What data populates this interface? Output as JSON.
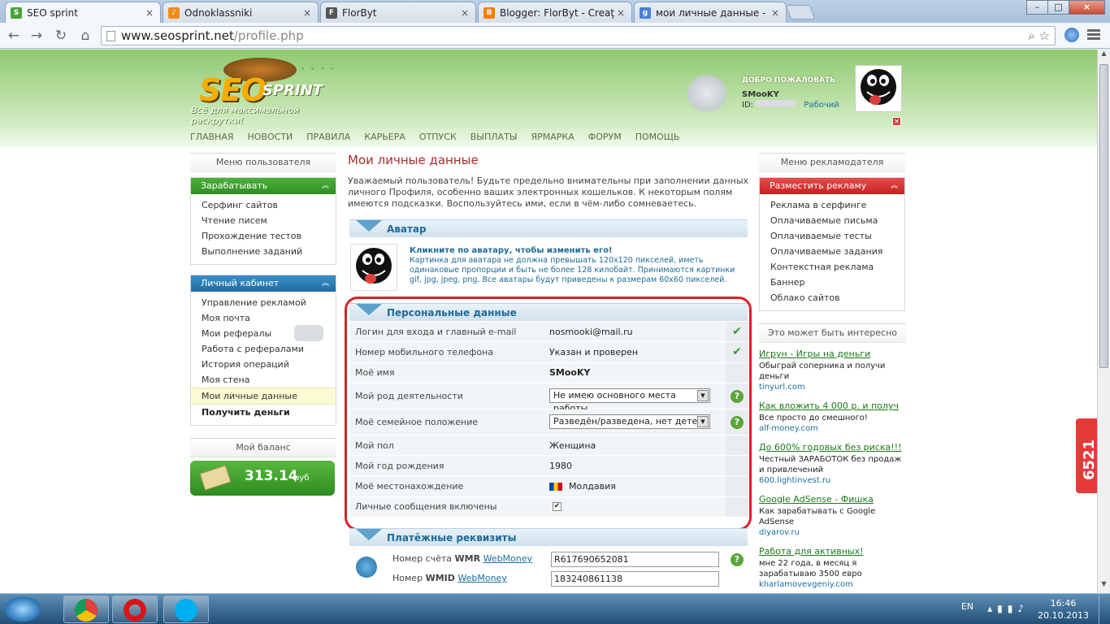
{
  "tabs": [
    {
      "title": "SEO sprint",
      "icon": "seosprint-icon",
      "color": "#4aa33a"
    },
    {
      "title": "Odnoklassniki",
      "icon": "odnoklassniki-icon",
      "color": "#f28a1b"
    },
    {
      "title": "FlorByt",
      "icon": "florbyt-icon",
      "color": "#555555"
    },
    {
      "title": "Blogger: FlorByt - Creaţi o",
      "icon": "blogger-icon",
      "color": "#f57d00"
    },
    {
      "title": "мои личные данные - По",
      "icon": "google-icon",
      "color": "#4a7fd4"
    }
  ],
  "address": {
    "host": "www.seosprint.net",
    "path": "/profile.php"
  },
  "site": {
    "logo_seo": "SEO",
    "logo_sprint": "SPRINT",
    "slogan": "Всё для максимальной раскрутки!",
    "welcome": "ДОБРО ПОЖАЛОВАТЬ",
    "nick": "SMooKY",
    "id_label": "ID:",
    "status": "Рабочий",
    "close": "×"
  },
  "nav": [
    "ГЛАВНАЯ",
    "НОВОСТИ",
    "ПРАВИЛА",
    "КАРЬЕРА",
    "ОТПУСК",
    "ВЫПЛАТЫ",
    "ЯРМАРКА",
    "ФОРУМ",
    "ПОМОЩЬ"
  ],
  "left": {
    "header": "Меню пользователя",
    "earn": {
      "title": "Зарабатывать",
      "items": [
        "Серфинг сайтов",
        "Чтение писем",
        "Прохождение тестов",
        "Выполнение заданий"
      ]
    },
    "cabinet": {
      "title": "Личный кабинет",
      "items": [
        "Управление рекламой",
        "Моя почта",
        "Мои рефералы",
        "Работа с рефералами",
        "История операций",
        "Моя стена",
        "Мои личные данные",
        "Получить деньги"
      ]
    },
    "balance_header": "Мой баланс",
    "balance": "313.14",
    "currency": "руб"
  },
  "right": {
    "header": "Меню рекламодателя",
    "ads": {
      "title": "Разместить рекламу",
      "items": [
        "Реклама в серфинге",
        "Оплачиваемые письма",
        "Оплачиваемые тесты",
        "Оплачиваемые задания",
        "Контекстная реклама",
        "Баннер",
        "Облако сайтов"
      ]
    },
    "interest_header": "Это может быть интересно",
    "interest": [
      {
        "title": "Игрун - Игры на деньги",
        "desc": "Обыграй соперника и получи деньги",
        "url": "tinyurl.com"
      },
      {
        "title": "Как вложить 4 000 р. и получ",
        "desc": "Все просто до смешного!",
        "url": "alf-money.com"
      },
      {
        "title": "До 600% годовых без риска!!!",
        "desc": "Честный ЗАРАБОТОК без продаж и привлечений",
        "url": "600.lightinvest.ru"
      },
      {
        "title": "Google AdSense - Фишка",
        "desc": "Как зарабатывать с Google AdSense",
        "url": "diyarov.ru"
      },
      {
        "title": "Работа для активных!",
        "desc": "мне 22 года, в месяц я зарабатываю 3500 евро",
        "url": "kharlamovevgeniy.com"
      }
    ]
  },
  "main": {
    "title": "Мои личные данные",
    "intro": "Уважаемый пользователь! Будьте предельно внимательны при заполнении данных личного Профиля, особенно ваших электронных кошельков. К некоторым полям имеются подсказки. Воспользуйтесь ими, если в чём-либо сомневаетесь.",
    "avatar_header": "Аватар",
    "avatar_click": "Кликните по аватару, чтобы изменить его!",
    "avatar_rules": "Картинка для аватара не должна превышать 120x120 пикселей, иметь одинаковые пропорции и быть не более 128 килобайт. Принимаются картинки gif, jpg, jpeg, png. Все аватары будут приведены к размерам 60x60 пикселей.",
    "personal_header": "Персональные данные",
    "rows": [
      {
        "label": "Логин для входа и главный e-mail",
        "value": "nosmooki@mail.ru"
      },
      {
        "label": "Номер мобильного телефона",
        "value": "Указан и проверен"
      },
      {
        "label": "Моё имя",
        "value": "SMooKY"
      },
      {
        "label": "Мой род деятельности",
        "value": "Не имею основного места работы"
      },
      {
        "label": "Моё семейное положение",
        "value": "Разведён/разведена, нет детей"
      },
      {
        "label": "Мой пол",
        "value": "Женщина"
      },
      {
        "label": "Мой год рождения",
        "value": "1980"
      },
      {
        "label": "Моё местонахождение",
        "value": "Молдавия"
      },
      {
        "label": "Личные сообщения включены",
        "value": "✔"
      }
    ],
    "payment_header": "Платёжные реквизиты",
    "wmr_label_prefix": "Номер счёта",
    "wmr_label_bold": "WMR",
    "wmid_label_prefix": "Номер",
    "wmid_label_bold": "WMID",
    "webmoney": "WebMoney",
    "wmr_value": "R617690652081",
    "wmid_value": "183240861138"
  },
  "side_counter": "6521",
  "taskbar": {
    "lang": "EN",
    "time": "16:46",
    "date": "20.10.2013"
  },
  "colors": {
    "accent_red": "#b02b2b",
    "frame_red": "#d9202a",
    "green": "#3c9a2a",
    "blue": "#1d6a98"
  }
}
